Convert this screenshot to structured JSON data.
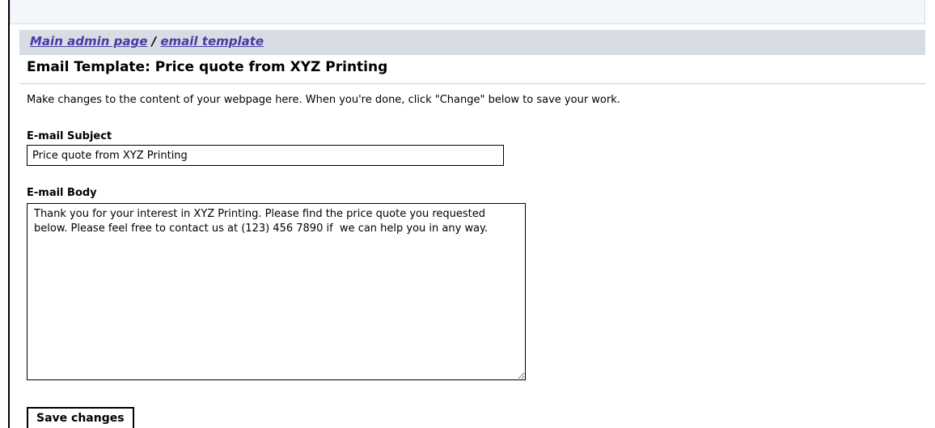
{
  "breadcrumb": {
    "main_link": "Main admin page",
    "separator": "/",
    "current_link": "email template"
  },
  "page": {
    "title": "Email Template: Price quote from XYZ Printing",
    "intro": "Make changes to the content of your webpage here. When you're done, click \"Change\" below to save your work."
  },
  "form": {
    "subject_label": "E-mail Subject",
    "subject_value": "Price quote from XYZ Printing",
    "body_label": "E-mail Body",
    "body_value": "Thank you for your interest in XYZ Printing. Please find the price quote you requested below. Please feel free to contact us at (123) 456 7890 if  we can help you in any way.",
    "save_label": "Save changes"
  },
  "colors": {
    "breadcrumb_bg": "#d7dde2",
    "link": "#4a3aa5",
    "top_strip_bg": "#f3f6fb"
  }
}
